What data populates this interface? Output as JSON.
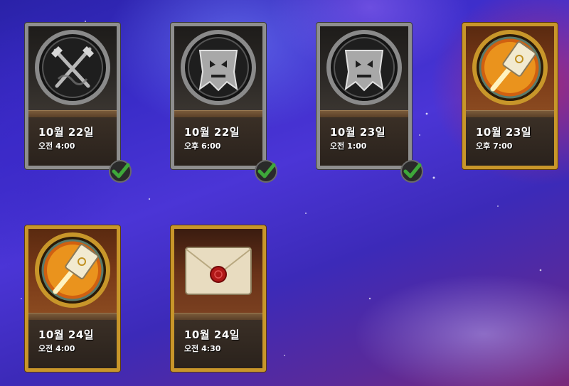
{
  "cards": [
    {
      "date": "10월 22일",
      "time": "오전 4:00",
      "icon": "crossed-swords-icon",
      "style": "silver",
      "completed": true
    },
    {
      "date": "10월 22일",
      "time": "오후 6:00",
      "icon": "horde-banner-icon",
      "style": "silver",
      "completed": true
    },
    {
      "date": "10월 23일",
      "time": "오전 1:00",
      "icon": "horde-banner-icon",
      "style": "silver",
      "completed": true
    },
    {
      "date": "10월 23일",
      "time": "오후 7:00",
      "icon": "golden-hammer-icon",
      "style": "gold",
      "completed": false
    },
    {
      "date": "10월 24일",
      "time": "오전 4:00",
      "icon": "golden-hammer-icon",
      "style": "gold",
      "completed": false
    },
    {
      "date": "10월 24일",
      "time": "오전 4:30",
      "icon": "sealed-letter-icon",
      "style": "gold",
      "completed": false
    }
  ],
  "colors": {
    "background": "#3a2cc8",
    "silver_frame": "#8e8e8e",
    "gold_frame": "#c8962a",
    "check_green": "#3ea83a"
  }
}
